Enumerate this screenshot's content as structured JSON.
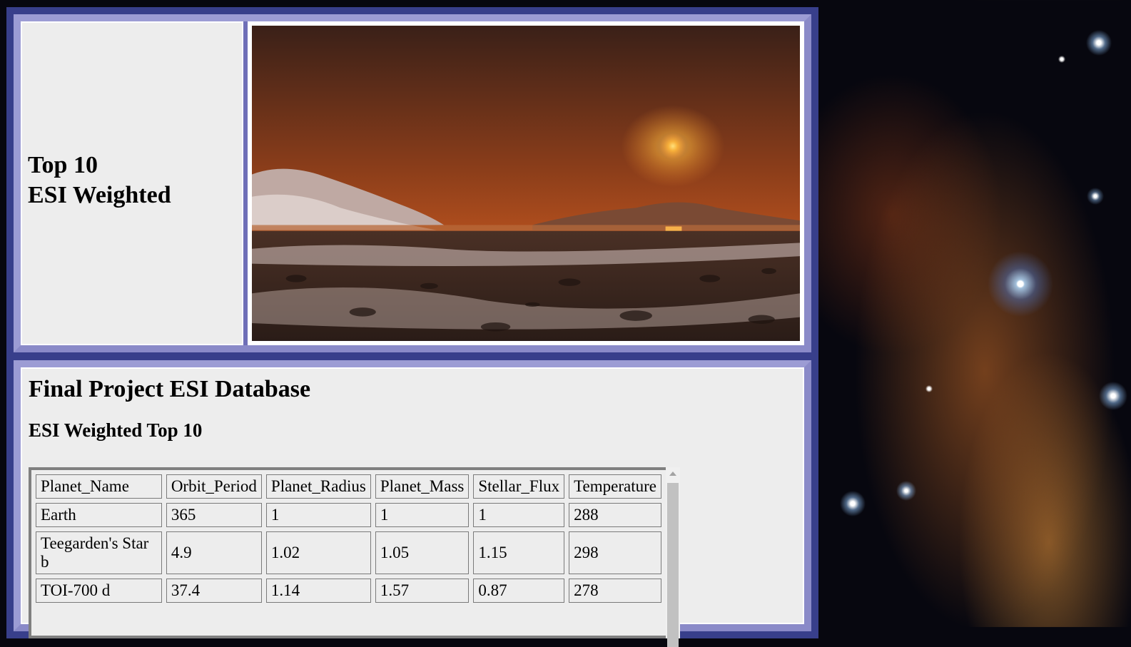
{
  "header": {
    "title_line1": "Top 10",
    "title_line2": "ESI Weighted",
    "image_alt": "Exoplanet sunset landscape"
  },
  "main": {
    "heading": "Final Project ESI Database",
    "subheading": "ESI Weighted Top 10",
    "table": {
      "columns": [
        "Planet_Name",
        "Orbit_Period",
        "Planet_Radius",
        "Planet_Mass",
        "Stellar_Flux",
        "Temperature"
      ],
      "rows": [
        [
          "Earth",
          "365",
          "1",
          "1",
          "1",
          "288"
        ],
        [
          "Teegarden's Star b",
          "4.9",
          "1.02",
          "1.05",
          "1.15",
          "298"
        ],
        [
          "TOI-700 d",
          "37.4",
          "1.14",
          "1.57",
          "0.87",
          "278"
        ]
      ]
    }
  },
  "colors": {
    "frame_dark": "#383f8b",
    "frame_light": "#8a8ac8",
    "panel_bg": "#ededed"
  }
}
